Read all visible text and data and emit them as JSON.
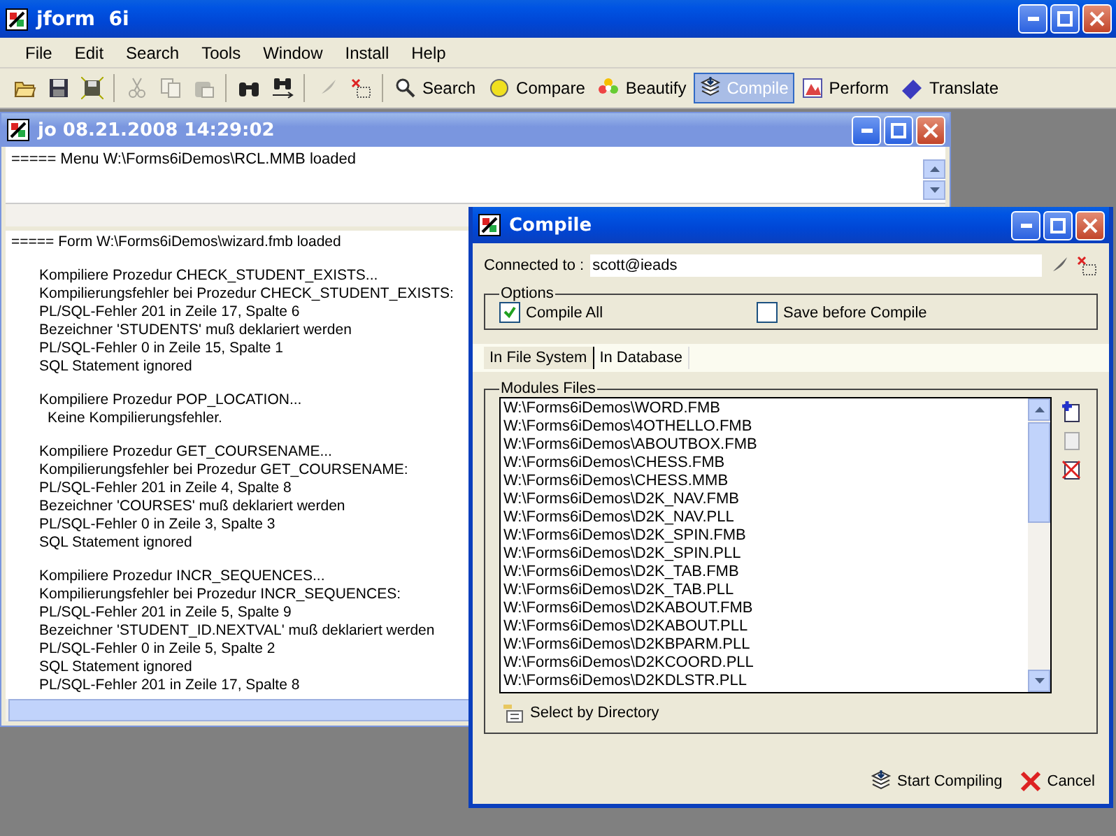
{
  "window": {
    "title": "jform  6i"
  },
  "menu": [
    "File",
    "Edit",
    "Search",
    "Tools",
    "Window",
    "Install",
    "Help"
  ],
  "toolbar": {
    "icon_buttons": [
      {
        "disabled": false
      },
      {
        "disabled": false
      },
      {
        "disabled": false
      },
      {
        "disabled": true
      },
      {
        "disabled": true
      },
      {
        "disabled": true
      },
      {
        "disabled": false
      },
      {
        "disabled": false
      },
      {
        "disabled": true
      },
      {
        "disabled": false
      }
    ],
    "tools": [
      {
        "label": "Search",
        "selected": false
      },
      {
        "label": "Compare",
        "selected": false
      },
      {
        "label": "Beautify",
        "selected": false
      },
      {
        "label": "Compile",
        "selected": true
      },
      {
        "label": "Perform",
        "selected": false
      },
      {
        "label": "Translate",
        "selected": false
      }
    ]
  },
  "child_window": {
    "title": "jo 08.21.2008 14:29:02",
    "top_pane": "===== Menu W:\\Forms6iDemos\\RCL.MMB loaded",
    "log": {
      "header": "===== Form W:\\Forms6iDemos\\wizard.fmb loaded",
      "blocks": [
        {
          "lines": [
            {
              "text": "Kompiliere Prozedur CHECK_STUDENT_EXISTS...",
              "kind": "line"
            },
            {
              "text": "Kompilierungsfehler bei Prozedur CHECK_STUDENT_EXISTS:",
              "kind": "line"
            },
            {
              "text": "PL/SQL-Fehler 201 in Zeile 17, Spalte 6",
              "kind": "line"
            },
            {
              "text": "Bezeichner 'STUDENTS' muß deklariert werden",
              "kind": "line"
            },
            {
              "text": "PL/SQL-Fehler 0 in Zeile 15, Spalte 1",
              "kind": "line"
            },
            {
              "text": "SQL Statement ignored",
              "kind": "line"
            }
          ]
        },
        {
          "lines": [
            {
              "text": "Kompiliere Prozedur POP_LOCATION...",
              "kind": "line"
            },
            {
              "text": "Keine Kompilierungsfehler.",
              "kind": "nested"
            }
          ]
        },
        {
          "lines": [
            {
              "text": "Kompiliere Prozedur GET_COURSENAME...",
              "kind": "line"
            },
            {
              "text": "Kompilierungsfehler bei Prozedur GET_COURSENAME:",
              "kind": "line"
            },
            {
              "text": "PL/SQL-Fehler 201 in Zeile 4, Spalte 8",
              "kind": "line"
            },
            {
              "text": "Bezeichner 'COURSES' muß deklariert werden",
              "kind": "line"
            },
            {
              "text": "PL/SQL-Fehler 0 in Zeile 3, Spalte 3",
              "kind": "line"
            },
            {
              "text": "SQL Statement ignored",
              "kind": "line"
            }
          ]
        },
        {
          "lines": [
            {
              "text": "Kompiliere Prozedur INCR_SEQUENCES...",
              "kind": "line"
            },
            {
              "text": "Kompilierungsfehler bei Prozedur INCR_SEQUENCES:",
              "kind": "line"
            },
            {
              "text": "PL/SQL-Fehler 201 in Zeile 5, Spalte 9",
              "kind": "line"
            },
            {
              "text": "Bezeichner 'STUDENT_ID.NEXTVAL' muß deklariert werden",
              "kind": "line"
            },
            {
              "text": "PL/SQL-Fehler 0 in Zeile 5, Spalte 2",
              "kind": "line"
            },
            {
              "text": "SQL Statement ignored",
              "kind": "line"
            },
            {
              "text": "PL/SQL-Fehler 201 in Zeile 17, Spalte 8",
              "kind": "line"
            }
          ]
        }
      ]
    }
  },
  "dialog": {
    "title": "Compile",
    "connected_label": "Connected to :",
    "connected_value": "scott@ieads",
    "options_label": "Options",
    "options": [
      {
        "label": "Compile All",
        "checked": true
      },
      {
        "label": "Save before Compile",
        "checked": false
      }
    ],
    "tabs": [
      {
        "label": "In File System",
        "selected": true
      },
      {
        "label": "In Database",
        "selected": false
      }
    ],
    "modules_label": "Modules Files",
    "modules": [
      "W:\\Forms6iDemos\\WORD.FMB",
      "W:\\Forms6iDemos\\4OTHELLO.FMB",
      "W:\\Forms6iDemos\\ABOUTBOX.FMB",
      "W:\\Forms6iDemos\\CHESS.FMB",
      "W:\\Forms6iDemos\\CHESS.MMB",
      "W:\\Forms6iDemos\\D2K_NAV.FMB",
      "W:\\Forms6iDemos\\D2K_NAV.PLL",
      "W:\\Forms6iDemos\\D2K_SPIN.FMB",
      "W:\\Forms6iDemos\\D2K_SPIN.PLL",
      "W:\\Forms6iDemos\\D2K_TAB.FMB",
      "W:\\Forms6iDemos\\D2K_TAB.PLL",
      "W:\\Forms6iDemos\\D2KABOUT.FMB",
      "W:\\Forms6iDemos\\D2KABOUT.PLL",
      "W:\\Forms6iDemos\\D2KBPARM.PLL",
      "W:\\Forms6iDemos\\D2KCOORD.PLL",
      "W:\\Forms6iDemos\\D2KDLSTR.PLL"
    ],
    "select_dir": "Select by Directory",
    "start": "Start Compiling",
    "cancel": "Cancel"
  }
}
